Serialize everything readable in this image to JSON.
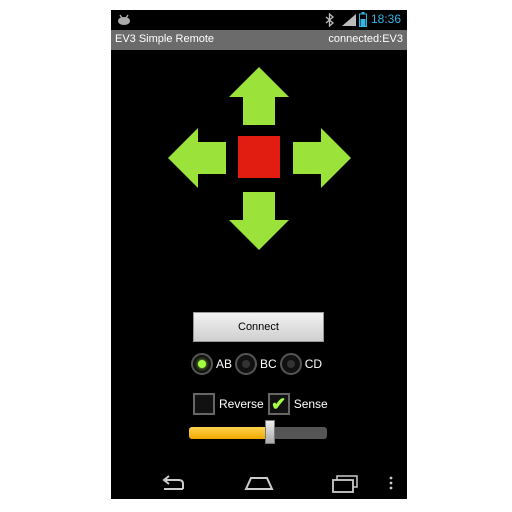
{
  "status_bar": {
    "time": "18:36",
    "icons": [
      "android-icon",
      "bluetooth-icon",
      "signal-icon",
      "battery-icon"
    ]
  },
  "app": {
    "title": "EV3 Simple Remote",
    "connection_status": "connected:EV3"
  },
  "dpad": {
    "arrow_color": "#9be23a",
    "stop_color": "#e11d12",
    "controls": [
      "up-arrow",
      "left-arrow",
      "right-arrow",
      "down-arrow",
      "stop"
    ]
  },
  "connect_button": {
    "label": "Connect"
  },
  "motor_ports": {
    "options": [
      "AB",
      "BC",
      "CD"
    ],
    "selected": "AB"
  },
  "options": {
    "reverse": {
      "label": "Reverse",
      "checked": false
    },
    "sense": {
      "label": "Sense",
      "checked": true
    }
  },
  "speed_slider": {
    "value_fraction": 0.59
  },
  "nav_bar": {
    "icons": [
      "back-icon",
      "home-icon",
      "recent-apps-icon",
      "menu-icon"
    ]
  }
}
